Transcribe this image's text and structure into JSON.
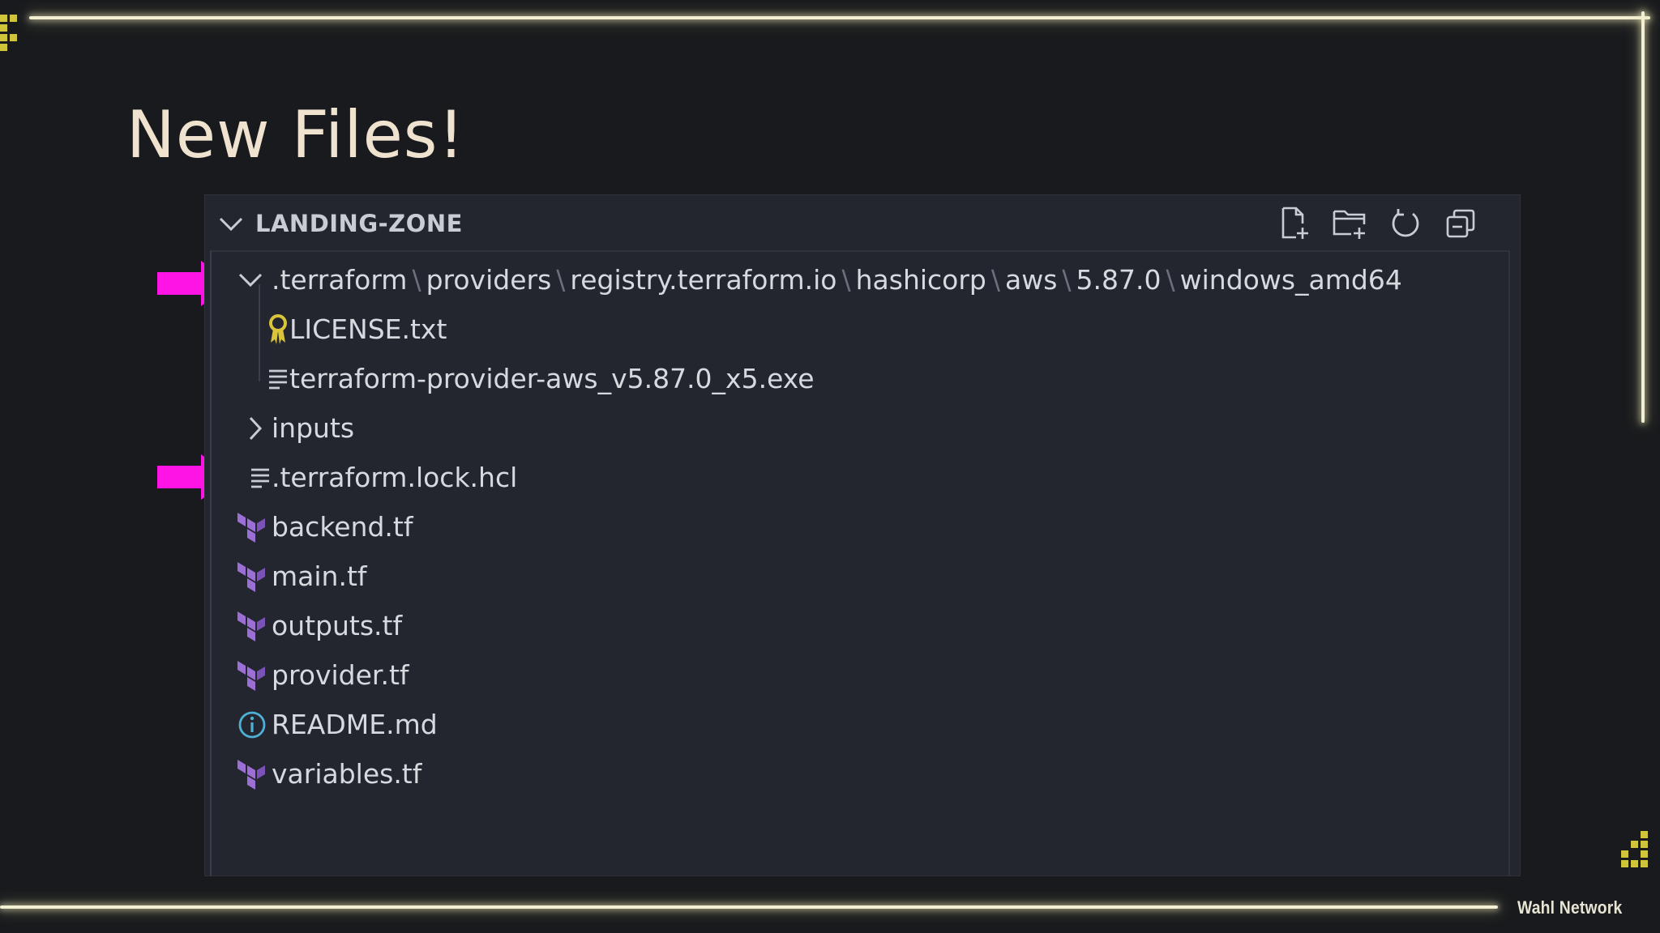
{
  "slide": {
    "title": "New Files!",
    "watermark": "Wahl Network",
    "colors": {
      "background": "#181a1d",
      "frame": "#f2efd2",
      "accent_pixels": "#cfc43a",
      "arrow": "#ff14e6",
      "terraform_icon": "#9b6fd3"
    }
  },
  "explorer": {
    "root_label": "LANDING-ZONE",
    "actions": [
      {
        "name": "new-file-icon",
        "label": "New File"
      },
      {
        "name": "new-folder-icon",
        "label": "New Folder"
      },
      {
        "name": "refresh-icon",
        "label": "Refresh Explorer"
      },
      {
        "name": "collapse-all-icon",
        "label": "Collapse Folders in Explorer"
      }
    ],
    "folder_path": {
      "segments": [
        ".terraform",
        "providers",
        "registry.terraform.io",
        "hashicorp",
        "aws",
        "5.87.0",
        "windows_amd64"
      ],
      "separator": "\\"
    },
    "folder_children": [
      {
        "name": "LICENSE.txt",
        "icon": "license-icon"
      },
      {
        "name": "terraform-provider-aws_v5.87.0_x5.exe",
        "icon": "lines-file-icon"
      }
    ],
    "inputs_folder": "inputs",
    "files": [
      {
        "name": ".terraform.lock.hcl",
        "icon": "lines-file-icon"
      },
      {
        "name": "backend.tf",
        "icon": "terraform-icon"
      },
      {
        "name": "main.tf",
        "icon": "terraform-icon"
      },
      {
        "name": "outputs.tf",
        "icon": "terraform-icon"
      },
      {
        "name": "provider.tf",
        "icon": "terraform-icon"
      },
      {
        "name": "README.md",
        "icon": "info-icon"
      },
      {
        "name": "variables.tf",
        "icon": "terraform-icon"
      }
    ]
  }
}
